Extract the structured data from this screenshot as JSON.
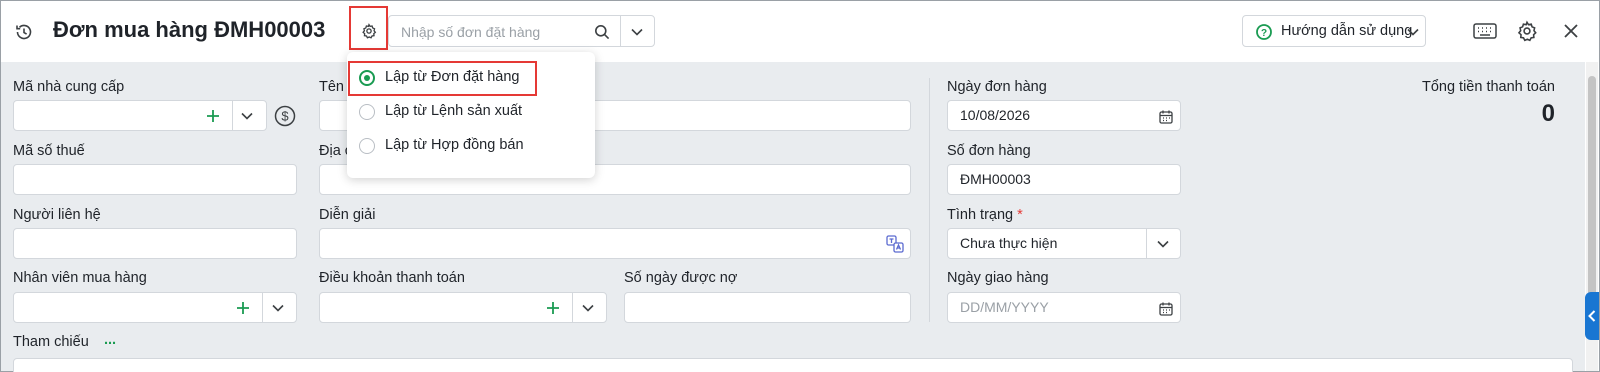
{
  "header": {
    "title": "Đơn mua hàng ĐMH00003",
    "search_placeholder": "Nhập số đơn đặt hàng",
    "help_label": "Hướng dẫn sử dụng"
  },
  "dropdown": {
    "options": [
      {
        "label": "Lập từ Đơn đặt hàng",
        "selected": true
      },
      {
        "label": "Lập từ Lệnh sản xuất",
        "selected": false
      },
      {
        "label": "Lập từ Hợp đồng bán",
        "selected": false
      }
    ]
  },
  "form": {
    "supplier_code_label": "Mã nhà cung cấp",
    "supplier_name_label": "Tên n",
    "tax_code_label": "Mã số thuế",
    "address_label": "Địa ch",
    "contact_label": "Người liên hệ",
    "description_label": "Diễn giải",
    "buyer_label": "Nhân viên mua hàng",
    "payment_terms_label": "Điều khoản thanh toán",
    "debt_days_label": "Số ngày được nợ",
    "reference_label": "Tham chiếu",
    "reference_more": "...",
    "order_date_label": "Ngày đơn hàng",
    "order_date_value": "10/08/2026",
    "order_no_label": "Số đơn hàng",
    "order_no_value": "ĐMH00003",
    "status_label": "Tình trạng",
    "status_required": "*",
    "status_value": "Chưa thực hiện",
    "delivery_date_label": "Ngày giao hàng",
    "delivery_date_placeholder": "DD/MM/YYYY",
    "total_label": "Tổng tiền thanh toán",
    "total_value": "0"
  },
  "colors": {
    "accent_green": "#1a9b52",
    "highlight_red": "#e53935",
    "side_tab_blue": "#1976d2",
    "form_bg": "#e9ecef"
  }
}
